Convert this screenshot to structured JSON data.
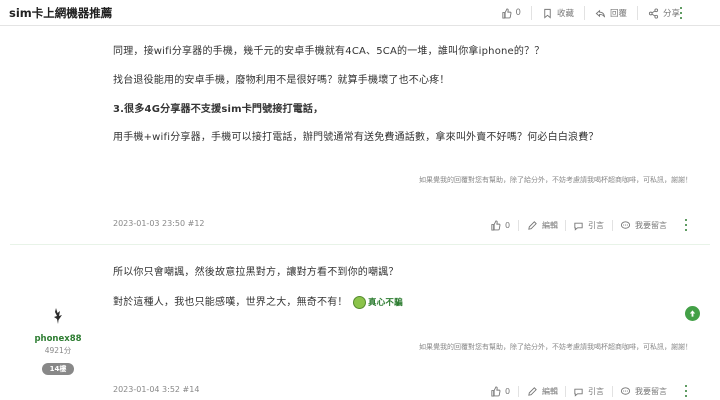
{
  "topbar": {
    "title": "sim卡上網機器推薦",
    "like_count": "0",
    "bookmark_label": "收藏",
    "reply_label": "回覆",
    "share_label": "分享"
  },
  "post12": {
    "paragraphs": [
      "同理，接wifi分享器的手機，幾千元的安卓手機就有4CA、5CA的一堆，誰叫你拿iphone的？？",
      "找台退役能用的安卓手機，廢物利用不是很好嗎？就算手機壞了也不心疼！",
      "3.很多4G分享器不支援sim卡門號接打電話，",
      "用手機+wifi分享器，手機可以接打電話，辦門號通常有送免費通話數，拿來叫外賣不好嗎？何必白白浪費？"
    ],
    "signature": "如果覺我的回覆對您有幫助，除了給分外，不妨考慮請我喝杯超商咖啡，可私訊，謝謝！",
    "timestamp": "2023-01-03 23:50 #12",
    "like_count": "0",
    "edit_label": "編輯",
    "quote_label": "引言",
    "comment_label": "我要留言"
  },
  "post14": {
    "paragraphs": [
      "所以你只會嘲諷，然後故意拉黑對方，讓對方看不到你的嘲諷？",
      "對於這種人，我也只能感嘆，世界之大，無奇不有！"
    ],
    "emoji_text": "真心不騙",
    "signature": "如果覺我的回覆對您有幫助，除了給分外，不妨考慮請我喝杯超商咖啡，可私訊，謝謝！",
    "timestamp": "2023-01-04 3:52 #14",
    "like_count": "0",
    "edit_label": "編輯",
    "quote_label": "引言",
    "comment_label": "我要留言",
    "user": {
      "name": "phonex88",
      "score": "4921分",
      "floor": "14樓"
    }
  },
  "colors": {
    "accent": "#2e7d32",
    "float_button": "#43a047"
  }
}
